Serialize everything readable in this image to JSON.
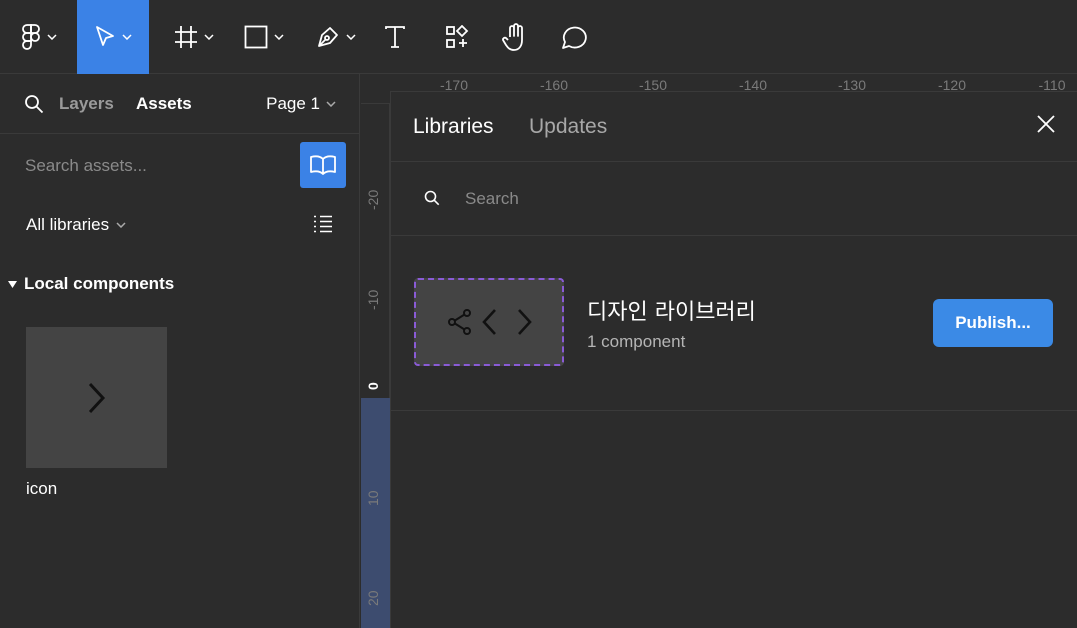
{
  "toolbar": {
    "tools": [
      {
        "name": "main-menu",
        "icon": "figma-logo-icon"
      },
      {
        "name": "move",
        "icon": "cursor-icon",
        "active": true
      },
      {
        "name": "frame",
        "icon": "frame-hash-icon"
      },
      {
        "name": "shape",
        "icon": "rectangle-icon"
      },
      {
        "name": "pen",
        "icon": "pen-icon"
      },
      {
        "name": "text",
        "icon": "text-icon"
      },
      {
        "name": "resources",
        "icon": "resources-icon"
      },
      {
        "name": "hand",
        "icon": "hand-icon"
      },
      {
        "name": "comment",
        "icon": "comment-icon"
      }
    ],
    "active_color": "#3b82e6"
  },
  "left_panel": {
    "tabs": {
      "layers": "Layers",
      "assets": "Assets"
    },
    "page": "Page 1",
    "search_placeholder": "Search assets...",
    "libraries_filter": "All libraries",
    "section_title": "Local components",
    "components": [
      {
        "label": "icon",
        "icon": "chevron-right-icon"
      }
    ]
  },
  "rulers": {
    "top": [
      "-170",
      "-160",
      "-150",
      "-140",
      "-130",
      "-120",
      "-110"
    ],
    "left": [
      "-20",
      "-10",
      "0",
      "10",
      "20"
    ]
  },
  "libraries_modal": {
    "tabs": {
      "libraries": "Libraries",
      "updates": "Updates"
    },
    "search_placeholder": "Search",
    "library": {
      "name": "디자인 라이브러리",
      "count": "1 component",
      "thumbnail_icons": [
        "share-icon",
        "code-brackets-icon"
      ]
    },
    "publish_label": "Publish...",
    "accent": "#3b8ae6",
    "thumbnail_border": "#8a5bd6"
  }
}
